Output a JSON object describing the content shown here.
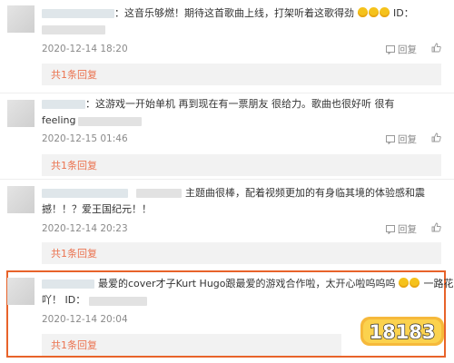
{
  "comments": [
    {
      "text_line1": "：这音乐够燃！期待这首歌曲上线，打架听着这歌得劲",
      "text_line1_suffix": "ID：",
      "text_line2": "",
      "timestamp": "2020-12-14 18:20",
      "reply_label": "回复",
      "reply_count_label": "共1条回复"
    },
    {
      "text_line1": "：这游戏一开始单机 再到现在有一票朋友 很给力。歌曲也很好听 很有",
      "text_line2": "feeling",
      "timestamp": "2020-12-15 01:46",
      "reply_label": "回复",
      "reply_count_label": "共1条回复"
    },
    {
      "text_line1": "主题曲很棒，配着视频更加的有身临其境的体验感和震",
      "text_line2": "撼！！？爱王国纪元！！",
      "timestamp": "2020-12-14 20:23",
      "reply_label": "回复",
      "reply_count_label": "共1条回复"
    },
    {
      "text_line1": "最爱的cover才子Kurt Hugo跟最爱的游戏合作啦，太开心啦呜呜呜",
      "text_line1_suffix": "一路花路",
      "text_line2": "吖！ ID：",
      "timestamp": "2020-12-14 20:04",
      "reply_label": "回复",
      "reply_count_label": "共1条回复"
    }
  ],
  "icons": {
    "like": "thumbs-up-icon",
    "reply_box": "reply-area"
  },
  "colors": {
    "accent": "#eb7350",
    "highlight_border": "#e8632a",
    "emoji": "#f5c21b"
  },
  "watermark": {
    "logo_text": "18183"
  }
}
